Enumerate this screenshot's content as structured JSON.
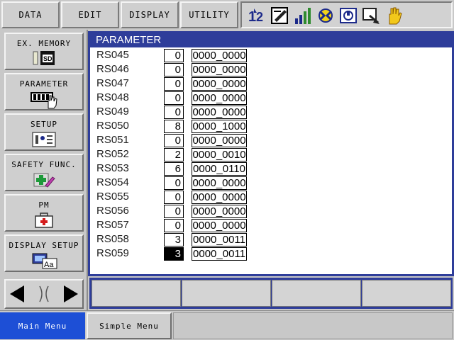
{
  "topbar": {
    "menus": [
      "DATA",
      "EDIT",
      "DISPLAY",
      "UTILITY"
    ],
    "status_icons": [
      "tool-number-icon",
      "edit-mode-icon",
      "signal-bars-icon",
      "cycle-icon",
      "servo-icon",
      "monitor-arrow-icon",
      "hand-icon"
    ]
  },
  "leftmenu": {
    "items": [
      {
        "label": "EX. MEMORY",
        "icon": "sd-card-icon"
      },
      {
        "label": "PARAMETER",
        "icon": "parameter-hand-icon"
      },
      {
        "label": "SETUP",
        "icon": "setup-icon"
      },
      {
        "label": "SAFETY FUNC.",
        "icon": "safety-cross-icon"
      },
      {
        "label": "PM",
        "icon": "first-aid-kit-icon"
      },
      {
        "label": "DISPLAY SETUP",
        "icon": "display-font-icon"
      }
    ]
  },
  "content": {
    "title": "PARAMETER",
    "rows": [
      {
        "name": "RS045",
        "value": "0",
        "binary": "0000_0000"
      },
      {
        "name": "RS046",
        "value": "0",
        "binary": "0000_0000"
      },
      {
        "name": "RS047",
        "value": "0",
        "binary": "0000_0000"
      },
      {
        "name": "RS048",
        "value": "0",
        "binary": "0000_0000"
      },
      {
        "name": "RS049",
        "value": "0",
        "binary": "0000_0000"
      },
      {
        "name": "RS050",
        "value": "8",
        "binary": "0000_1000"
      },
      {
        "name": "RS051",
        "value": "0",
        "binary": "0000_0000"
      },
      {
        "name": "RS052",
        "value": "2",
        "binary": "0000_0010"
      },
      {
        "name": "RS053",
        "value": "6",
        "binary": "0000_0110"
      },
      {
        "name": "RS054",
        "value": "0",
        "binary": "0000_0000"
      },
      {
        "name": "RS055",
        "value": "0",
        "binary": "0000_0000"
      },
      {
        "name": "RS056",
        "value": "0",
        "binary": "0000_0000"
      },
      {
        "name": "RS057",
        "value": "0",
        "binary": "0000_0000"
      },
      {
        "name": "RS058",
        "value": "3",
        "binary": "0000_0011"
      },
      {
        "name": "RS059",
        "value": "3",
        "binary": "0000_0011",
        "selected": true
      }
    ]
  },
  "fkeys": [
    "",
    "",
    "",
    ""
  ],
  "tabs": {
    "main": "Main Menu",
    "simple": "Simple Menu"
  },
  "colors": {
    "accent": "#2e3d9a",
    "tab_active": "#1d4fd6",
    "panel": "#c8c8c8"
  }
}
